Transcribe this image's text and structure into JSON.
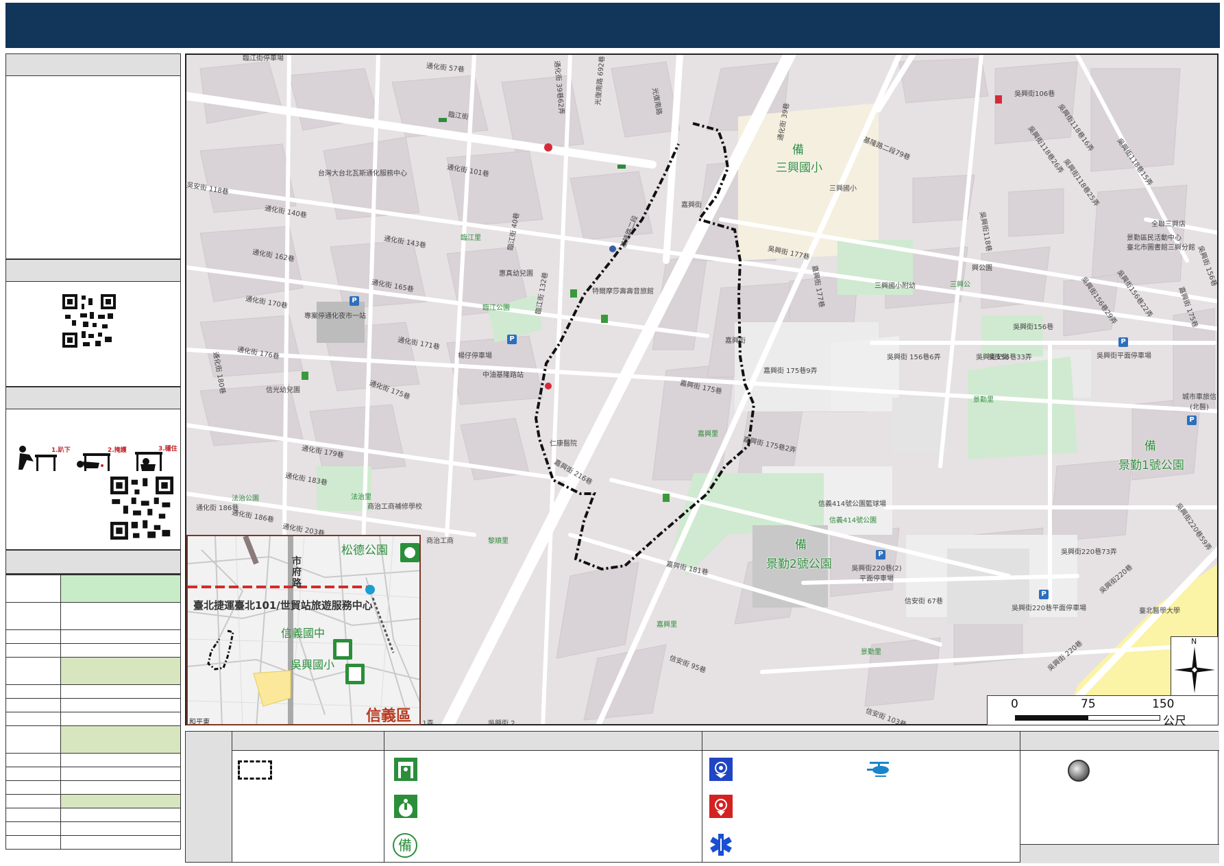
{
  "streets": {
    "s1": "臨江街停車場",
    "s2": "通化街 57巷",
    "s3": "通化街 39巷62弄",
    "s4": "光復南路 692巷",
    "s5": "光復南路",
    "s6": "臨江街",
    "s7": "台灣大台北瓦斯通化服務中心",
    "s8": "通化街 101巷",
    "s9": "通化街 140巷",
    "s10": "吳安街 118巷",
    "s11": "通化街 162巷",
    "s12": "通化街 143巷",
    "s13": "臨江里",
    "s14": "臨江街 40巷",
    "s15": "通化街 165巷",
    "s16": "通化街 170巷",
    "s17": "專案停通化夜市一站",
    "s18": "惠真幼兒園",
    "s19": "臨江公園",
    "s20": "通化街 171巷",
    "s21": "通化街 176巷",
    "s22": "楊仔停車場",
    "s23": "中油基隆路站",
    "s24": "信光幼兒園",
    "s25": "通化街 175巷",
    "s26": "通化街 179巷",
    "s27": "通化街 180巷",
    "s28": "通化街 183巷",
    "s29": "法治公園",
    "s30": "法治里",
    "s31": "商治工商補修學校",
    "s32": "通化街 186巷",
    "s33": "通化街 186巷",
    "s34": "通化街 203巷",
    "s35": "商治工商",
    "s36": "黎順里",
    "s37": "仁康醫院",
    "s38": "嘉興街 216巷",
    "s39": "嘉興里",
    "s40": "嘉興街 175巷",
    "s41": "嘉興街",
    "s42": "嘉興街 175巷9弄",
    "s43": "嘉興街 175巷2弄",
    "s44": "嘉興街 181巷",
    "s45": "嘉興里",
    "s46": "信安街 95巷",
    "s47": "信安街 67巷",
    "s48": "信安街 103巷",
    "s49": "景勤里",
    "s50": "信義414號公園籃球場",
    "s51": "信義414號公園",
    "s52": "吳興街220巷(2)平面停車場",
    "s53": "基隆路二段79巷",
    "s54": "三興國小",
    "s55": "三興國小附幼",
    "s56": "興公園",
    "s57": "三興公",
    "s58": "吳興街 177巷",
    "s59": "吳興街106巷",
    "s60": "吳興街118巷16弄",
    "s61": "吳興街118巷26弄",
    "s62": "吳興街118巷25弄",
    "s63": "吳興街118巷15弄",
    "s64": "吳興街118巷",
    "s65": "全聯三興店",
    "s66": "景勤區民活動中心",
    "s67": "臺北市圖書館三興分館",
    "s68": "吳興街156巷",
    "s69": "吳興街 156巷6弄",
    "s70": "吳興街156巷33弄",
    "s71": "吳興街156巷29弄",
    "s72": "吳興街156巷22弄",
    "s73": "吳興街平面停車場",
    "s74": "景勤里",
    "s75": "城市車旅信(北醫)",
    "s76": "吳興街220巷73弄",
    "s77": "吳興街220巷平面停車場",
    "s78": "吳興街220巷",
    "s79": "吳興街220巷59弄",
    "s80": "臺北醫學大學",
    "s81": "吳興街 220巷",
    "s82": "嘉興街",
    "s83": "嘉興街",
    "s84": "信義區",
    "s85": "吳安街",
    "s86": "嘉興街 177巷",
    "s87": "吳興街 156巷",
    "s88": "通化街 39巷",
    "s89": "臨江街 132巷",
    "s90": "基隆路二段",
    "s91": "福德街",
    "s92": "特爾摩莎壽壽音旅館",
    "s93": "嘉興街 175巷",
    "s94": "嘉興公",
    "s95": "吳興街 156巷",
    "s96": "嘉興公"
  },
  "map_labels": {
    "school": "三興國小",
    "park1": "景勤1號公園",
    "park2": "景勤2號公園",
    "shelter_glyph": "備",
    "north": "N"
  },
  "inset": {
    "songde": "松德公園",
    "shifu_1": "市",
    "shifu_2": "府",
    "shifu_3": "路",
    "mrt": "臺北捷運臺北101/世貿站旅遊服務中心",
    "xinyi_junior": "信義國中",
    "wuxing": "吳興國小",
    "district": "信義區",
    "edge": "和平東"
  },
  "scale": {
    "t0": "0",
    "t1": "75",
    "t2": "150",
    "unit": "公尺"
  },
  "drill_steps": {
    "step1": "1.趴下",
    "step2": "2.掩護",
    "step3": "3.穩住"
  },
  "colors": {
    "header": "#12355a",
    "table_green": "#c9ecc8",
    "table_olive": "#d8e6c0",
    "boundary": "#111111",
    "shelter_green": "#2f8a3c",
    "police_blue": "#1f45c4",
    "fire_red": "#d32222",
    "ems_blue": "#1a4fd1"
  },
  "icons": {
    "shelter": "evacuation-building-icon",
    "assembly": "assembly-point-icon",
    "reserve": "reserve-shelter-icon",
    "police": "police-icon",
    "fire": "fire-department-icon",
    "ems": "ems-star-of-life-icon",
    "helicopter": "helicopter-icon",
    "gray_dot": "gray-circle-icon"
  },
  "edge_fragments": {
    "e1": "11弄",
    "e2": "吳興街 2"
  }
}
